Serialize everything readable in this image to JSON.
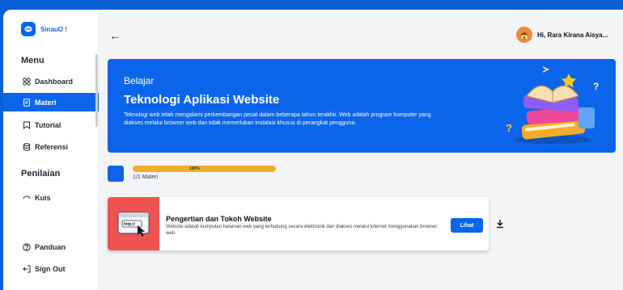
{
  "app": {
    "name": "SinauO !"
  },
  "sidebar": {
    "menu_heading": "Menu",
    "items": [
      {
        "label": "Dashboard",
        "icon": "grid-icon"
      },
      {
        "label": "Materi",
        "icon": "document-icon",
        "active": true
      },
      {
        "label": "Tutorial",
        "icon": "bookmark-icon"
      },
      {
        "label": "Referensi",
        "icon": "database-icon"
      }
    ],
    "penilaian_heading": "Penilaian",
    "kuis_label": "Kuis",
    "bottom": [
      {
        "label": "Panduan",
        "icon": "help-icon"
      },
      {
        "label": "Sign Out",
        "icon": "sign-out-icon"
      }
    ]
  },
  "header": {
    "user_greeting": "Hi, Rara Kirana Aisya..."
  },
  "hero": {
    "subtitle": "Belajar",
    "title": "Teknologi Aplikasi Website",
    "description": "Teknologi web telah mengalami perkembangan pesat dalam beberapa tahun terakhir. Web adalah program komputer yang diakses melalui browser web dan tidak memerlukan instalasi khusus di perangkat pengguna."
  },
  "progress": {
    "percent_label": "100%",
    "value": 1.0,
    "count_label": "1/1 Materi"
  },
  "materi": [
    {
      "title": "Pengertian dan Tokoh Website",
      "description": "Website adalah kumpulan halaman web yang terhubung secara elektronik dan diakses melalui internet menggunakan browser web.",
      "button_label": "Lihat",
      "thumb_text": "http://"
    }
  ],
  "colors": {
    "primary": "#0b65ea",
    "progress": "#f4ad2b",
    "thumb": "#ef5350",
    "avatar": "#f08a3a"
  }
}
